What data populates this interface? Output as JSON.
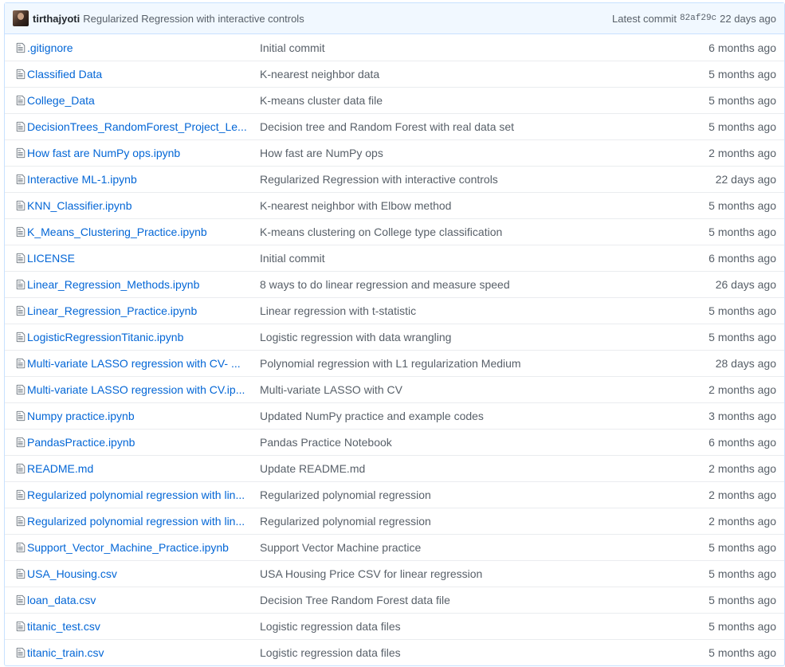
{
  "commit": {
    "author": "tirthajyoti",
    "message": "Regularized Regression with interactive controls",
    "latest_label": "Latest commit",
    "sha": "82af29c",
    "age": "22 days ago"
  },
  "files": [
    {
      "name": ".gitignore",
      "message": "Initial commit",
      "age": "6 months ago"
    },
    {
      "name": "Classified Data",
      "message": "K-nearest neighbor data",
      "age": "5 months ago"
    },
    {
      "name": "College_Data",
      "message": "K-means cluster data file",
      "age": "5 months ago"
    },
    {
      "name": "DecisionTrees_RandomForest_Project_Le...",
      "message": "Decision tree and Random Forest with real data set",
      "age": "5 months ago"
    },
    {
      "name": "How fast are NumPy ops.ipynb",
      "message": "How fast are NumPy ops",
      "age": "2 months ago"
    },
    {
      "name": "Interactive ML-1.ipynb",
      "message": "Regularized Regression with interactive controls",
      "age": "22 days ago"
    },
    {
      "name": "KNN_Classifier.ipynb",
      "message": "K-nearest neighbor with Elbow method",
      "age": "5 months ago"
    },
    {
      "name": "K_Means_Clustering_Practice.ipynb",
      "message": "K-means clustering on College type classification",
      "age": "5 months ago"
    },
    {
      "name": "LICENSE",
      "message": "Initial commit",
      "age": "6 months ago"
    },
    {
      "name": "Linear_Regression_Methods.ipynb",
      "message": "8 ways to do linear regression and measure speed",
      "age": "26 days ago"
    },
    {
      "name": "Linear_Regression_Practice.ipynb",
      "message": "Linear regression with t-statistic",
      "age": "5 months ago"
    },
    {
      "name": "LogisticRegressionTitanic.ipynb",
      "message": "Logistic regression with data wrangling",
      "age": "5 months ago"
    },
    {
      "name": "Multi-variate LASSO regression with CV- ...",
      "message": "Polynomial regression with L1 regularization Medium",
      "age": "28 days ago"
    },
    {
      "name": "Multi-variate LASSO regression with CV.ip...",
      "message": "Multi-variate LASSO with CV",
      "age": "2 months ago"
    },
    {
      "name": "Numpy practice.ipynb",
      "message": "Updated NumPy practice and example codes",
      "age": "3 months ago"
    },
    {
      "name": "PandasPractice.ipynb",
      "message": "Pandas Practice Notebook",
      "age": "6 months ago"
    },
    {
      "name": "README.md",
      "message": "Update README.md",
      "age": "2 months ago"
    },
    {
      "name": "Regularized polynomial regression with lin...",
      "message": "Regularized polynomial regression",
      "age": "2 months ago"
    },
    {
      "name": "Regularized polynomial regression with lin...",
      "message": "Regularized polynomial regression",
      "age": "2 months ago"
    },
    {
      "name": "Support_Vector_Machine_Practice.ipynb",
      "message": "Support Vector Machine practice",
      "age": "5 months ago"
    },
    {
      "name": "USA_Housing.csv",
      "message": "USA Housing Price CSV for linear regression",
      "age": "5 months ago"
    },
    {
      "name": "loan_data.csv",
      "message": "Decision Tree Random Forest data file",
      "age": "5 months ago"
    },
    {
      "name": "titanic_test.csv",
      "message": "Logistic regression data files",
      "age": "5 months ago"
    },
    {
      "name": "titanic_train.csv",
      "message": "Logistic regression data files",
      "age": "5 months ago"
    }
  ],
  "icons": {
    "file": "file-text-icon",
    "avatar": "avatar"
  },
  "colors": {
    "link": "#0366d6",
    "muted": "#586069",
    "header_bg": "#f1f8ff",
    "border": "#c8e1ff"
  }
}
